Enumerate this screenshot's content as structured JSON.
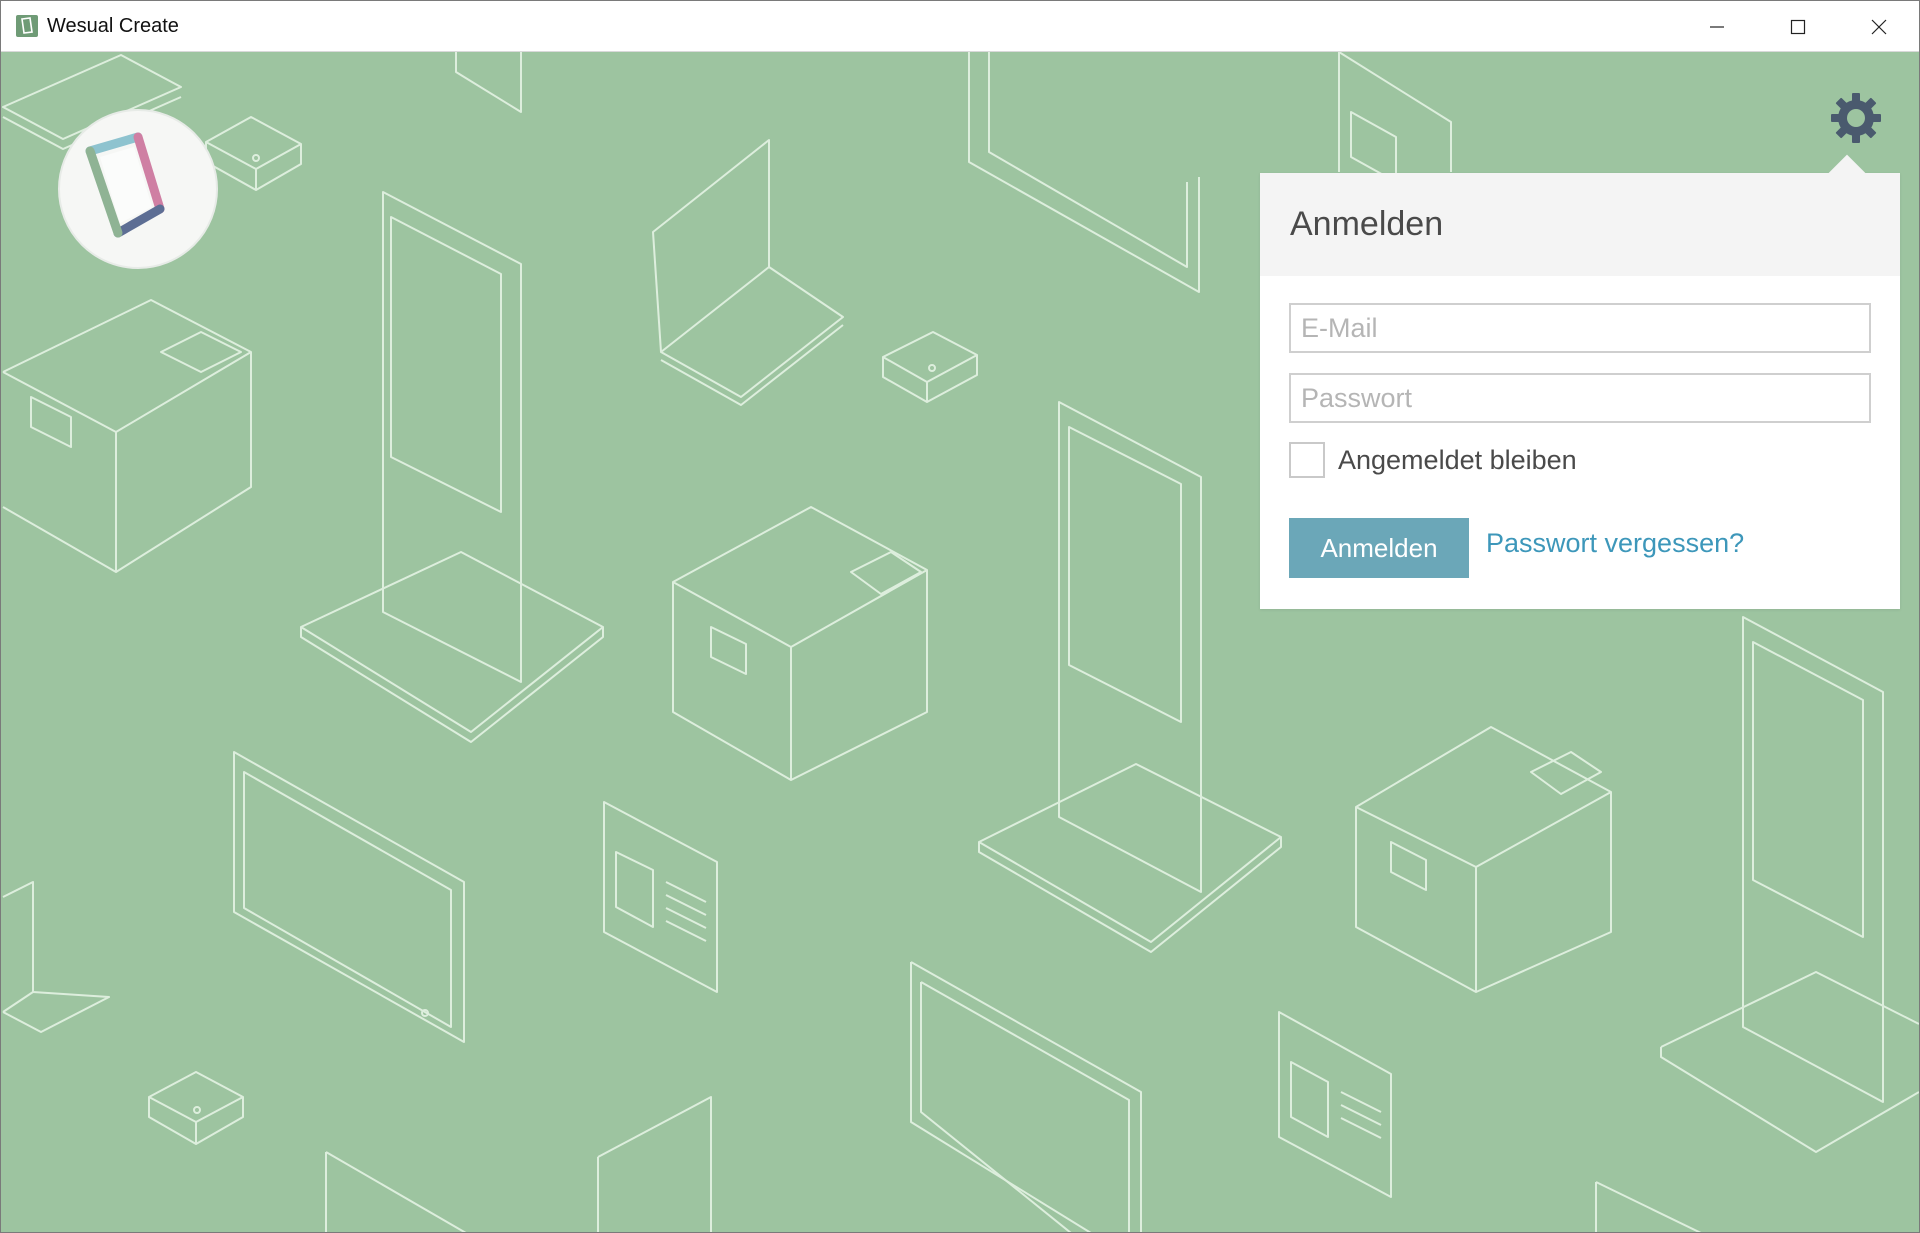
{
  "window": {
    "title": "Wesual Create",
    "controls": {
      "minimize": "minimize-icon",
      "maximize": "maximize-icon",
      "close": "close-icon"
    }
  },
  "colors": {
    "background": "#9dc4a0",
    "line_art": "#ddeedd",
    "accent_button": "#6ba7b8",
    "link": "#3d97ba",
    "gear": "#4a5a6e"
  },
  "settings": {
    "icon": "gear-icon"
  },
  "login": {
    "title": "Anmelden",
    "email": {
      "placeholder": "E-Mail",
      "value": ""
    },
    "password": {
      "placeholder": "Passwort",
      "value": ""
    },
    "remember": {
      "label": "Angemeldet bleiben",
      "checked": false
    },
    "submit_label": "Anmelden",
    "forgot_label": "Passwort vergessen?"
  }
}
